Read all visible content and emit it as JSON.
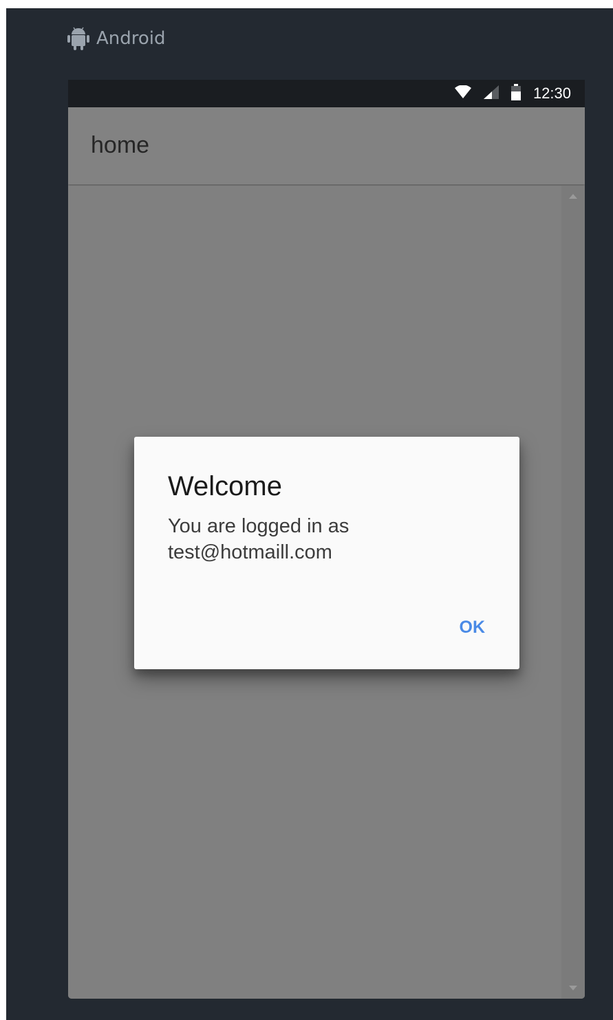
{
  "platform": {
    "label": "Android",
    "icon": "android-icon"
  },
  "status_bar": {
    "icons": [
      "wifi-icon",
      "cell-signal-icon",
      "battery-icon"
    ],
    "time": "12:30"
  },
  "app_bar": {
    "title": "home"
  },
  "dialog": {
    "title": "Welcome",
    "message": "You are logged in as test@hotmaill.com",
    "ok_label": "OK"
  },
  "colors": {
    "frame_bg": "#232931",
    "status_bar_bg": "#1a1d21",
    "dimmed_content": "#808080",
    "dialog_bg": "#fafafa",
    "accent": "#4a8ae6"
  }
}
